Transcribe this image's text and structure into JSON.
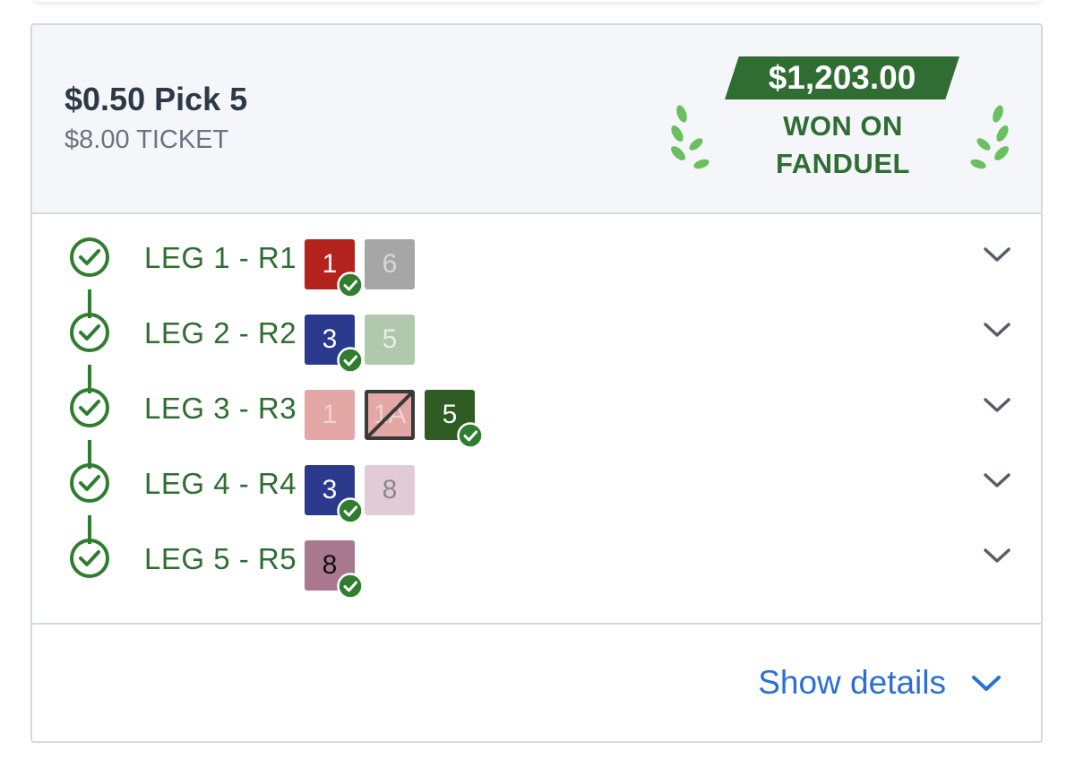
{
  "ticket": {
    "title": "$0.50 Pick 5",
    "subtitle": "$8.00 TICKET",
    "win_amount": "$1,203.00",
    "win_line1": "WON ON",
    "win_line2": "FANDUEL"
  },
  "colors": {
    "win_green": "#2f6d32",
    "check_green": "#2f7d2f",
    "link_blue": "#2b6fd5",
    "laurel_green": "#6abf5e"
  },
  "legs": [
    {
      "label": "LEG 1 - R1",
      "runners": [
        {
          "number": "1",
          "bg": "#b4221e",
          "fg": "#ffffff",
          "winner": true,
          "scratched": false
        },
        {
          "number": "6",
          "bg": "#a6a6a6",
          "fg": "#d8d8d8",
          "winner": false,
          "scratched": false
        }
      ]
    },
    {
      "label": "LEG 2 - R2",
      "runners": [
        {
          "number": "3",
          "bg": "#2b3a8c",
          "fg": "#ffffff",
          "winner": true,
          "scratched": false
        },
        {
          "number": "5",
          "bg": "#b0c9ac",
          "fg": "#e6efe4",
          "winner": false,
          "scratched": false
        }
      ]
    },
    {
      "label": "LEG 3 - R3",
      "runners": [
        {
          "number": "1",
          "bg": "#e3a7a5",
          "fg": "#f1d2d1",
          "winner": false,
          "scratched": false
        },
        {
          "number": "1A",
          "bg": "#e3a7a5",
          "fg": "#f1d2d1",
          "winner": false,
          "scratched": true
        },
        {
          "number": "5",
          "bg": "#2e5c22",
          "fg": "#ffffff",
          "winner": true,
          "scratched": false
        }
      ]
    },
    {
      "label": "LEG 4 - R4",
      "runners": [
        {
          "number": "3",
          "bg": "#2b3a8c",
          "fg": "#ffffff",
          "winner": true,
          "scratched": false
        },
        {
          "number": "8",
          "bg": "#e1ccd6",
          "fg": "#8a8a8a",
          "winner": false,
          "scratched": false
        }
      ]
    },
    {
      "label": "LEG 5 - R5",
      "runners": [
        {
          "number": "8",
          "bg": "#a9788f",
          "fg": "#111111",
          "winner": true,
          "scratched": false
        }
      ]
    }
  ],
  "icons": {
    "leg_status": "check-circle-icon",
    "winner_badge": "check-badge-icon",
    "expand": "chevron-down-icon",
    "decoration": "laurel-icon"
  },
  "footer": {
    "show_details_label": "Show details"
  }
}
